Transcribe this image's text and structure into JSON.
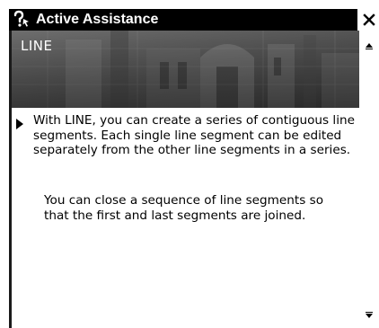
{
  "window": {
    "title": "Active Assistance",
    "close_icon": "close-icon",
    "help_icon": "help-question-icon"
  },
  "banner": {
    "title": "LINE"
  },
  "content": {
    "paragraph1": "With LINE, you can create a series of contiguous line segments. Each single line segment can be edited separately from the other line segments in a series.",
    "paragraph2": "You can close a sequence of line segments so that the first and last segments are joined."
  },
  "scrollbar": {
    "up_icon": "scroll-up-arrow-icon",
    "down_icon": "scroll-down-arrow-icon"
  },
  "colors": {
    "titlebar": "#000000",
    "banner": "#5a5a5a",
    "text": "#000000"
  }
}
